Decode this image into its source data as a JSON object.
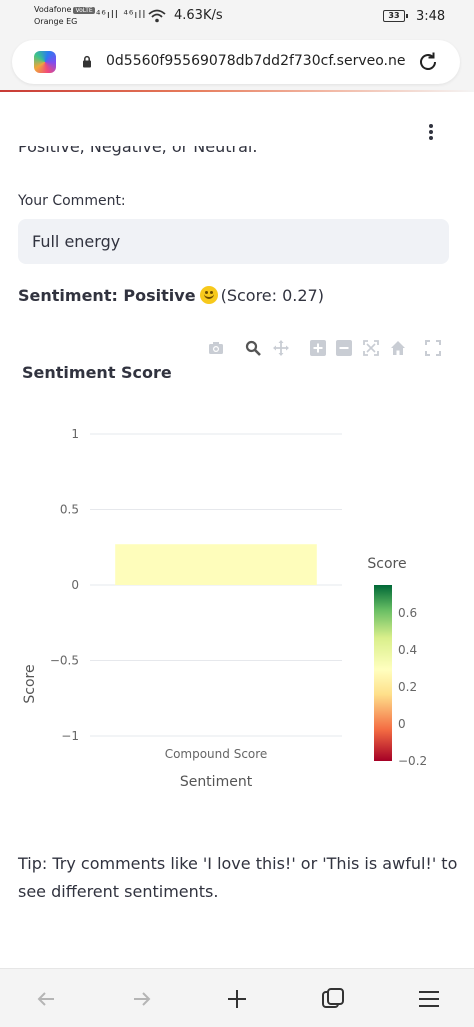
{
  "status_bar": {
    "carrier_primary": "Vodafone",
    "volte_badge": "VoLTE",
    "carrier_secondary": "Orange EG",
    "signal_text": "⁴⁶ıll ⁴⁶ıll",
    "network_speed": "4.63K/s",
    "battery_level": "33",
    "time": "3:48"
  },
  "browser": {
    "url": "0d5560f95569078db7dd2f730cf.serveo.ne",
    "icons": [
      "copilot-logo",
      "lock-icon",
      "reload-icon"
    ]
  },
  "page": {
    "cut_off_text": "Positive, Negative, or Neutral.",
    "input_label": "Your Comment:",
    "input_value": "Full energy",
    "sentiment_label": "Sentiment: Positive",
    "sentiment_score_text": "(Score: 0.27)",
    "tip": "Tip: Try comments like 'I love this!' or 'This is awful!' to see different sentiments."
  },
  "modebar_icons": [
    "camera-icon",
    "zoom-icon",
    "pan-icon",
    "zoom-in-icon",
    "zoom-out-icon",
    "autoscale-icon",
    "home-icon",
    "fullscreen-icon"
  ],
  "chart_data": {
    "type": "bar",
    "title": "Sentiment Score",
    "xlabel": "Sentiment",
    "ylabel": "Score",
    "categories": [
      "Compound Score"
    ],
    "values": [
      0.27
    ],
    "ylim": [
      -1,
      1
    ],
    "yticks": [
      "1",
      "0.5",
      "0",
      "−0.5",
      "−1"
    ],
    "ytick_values": [
      1,
      0.5,
      0,
      -0.5,
      -1
    ],
    "grid": true,
    "bar_color": "#fefdbb",
    "colorbar": {
      "title": "Score",
      "range": [
        -0.2,
        0.75
      ],
      "ticks": [
        "0.6",
        "0.4",
        "0.2",
        "0",
        "−0.2"
      ],
      "tick_values": [
        0.6,
        0.4,
        0.2,
        0,
        -0.2
      ],
      "colorscale": [
        "#a50026",
        "#f46d43",
        "#fee08b",
        "#ffffbf",
        "#d9ef8b",
        "#66bd63",
        "#006837"
      ]
    }
  },
  "bottom_nav": {
    "icons": [
      "back-arrow-icon",
      "forward-arrow-icon",
      "new-tab-icon",
      "tabs-icon",
      "menu-icon"
    ]
  }
}
